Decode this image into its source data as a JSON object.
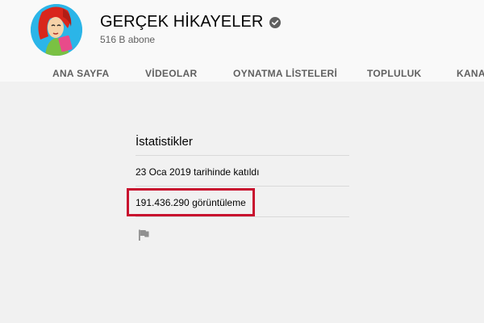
{
  "channel": {
    "name": "GERÇEK HİKAYELER",
    "subscribers": "516 B abone",
    "verified_icon": "verified-check-icon"
  },
  "tabs": [
    {
      "label": "ANA SAYFA"
    },
    {
      "label": "VİDEOLAR"
    },
    {
      "label": "OYNATMA LİSTELERİ"
    },
    {
      "label": "TOPLULUK"
    },
    {
      "label": "KANAL"
    }
  ],
  "about": {
    "stats_title": "İstatistikler",
    "joined": "23 Oca 2019 tarihinde katıldı",
    "views": "191.436.290 görüntüleme",
    "report_icon": "flag-icon"
  },
  "colors": {
    "highlight": "#c8102e",
    "header_bg": "#f9f9f9",
    "page_bg": "#f1f1f1"
  }
}
